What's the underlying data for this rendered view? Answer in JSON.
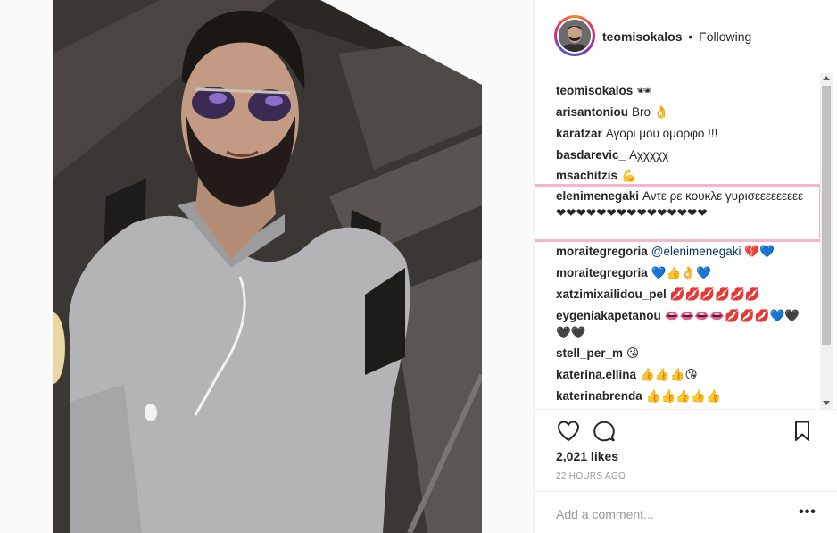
{
  "post": {
    "username": "teomisokalos",
    "separator": "•",
    "follow_status": "Following"
  },
  "comments": [
    {
      "user": "teomisokalos",
      "text": "🕶"
    },
    {
      "user": "arisantoniou",
      "text": "Bro 👌"
    },
    {
      "user": "karatzar",
      "text": "Αγορι μου ομορφο !!!"
    },
    {
      "user": "basdarevic_",
      "text": "Αχχχχχ"
    },
    {
      "user": "msachitzis",
      "text": "💪"
    },
    {
      "user": "elenimenegaki",
      "text": "Αντε ρε κουκλε γυρισεεεεεεεεε ❤❤❤❤❤❤❤❤❤❤❤❤❤❤❤"
    },
    {
      "user": "moraitegregoria",
      "mention": "@elenimenegaki",
      "text": "💔💙"
    },
    {
      "user": "moraitegregoria",
      "text": "💙👍👌💙"
    },
    {
      "user": "xatzimixailidou_pel",
      "text": "💋💋💋💋💋💋"
    },
    {
      "user": "eygeniakapetanou",
      "text": "👄👄👄👄💋💋💋💙🖤🖤🖤"
    },
    {
      "user": "stell_per_m",
      "text": "😘"
    },
    {
      "user": "katerina.ellina",
      "text": "👍👍👍😘"
    },
    {
      "user": "katerinabrenda",
      "text": "👍👍👍👍👍"
    }
  ],
  "actions": {
    "likes": "2,021 likes",
    "timestamp": "22 HOURS AGO",
    "icons": [
      "heart-icon",
      "comment-icon",
      "bookmark-icon",
      "more-options-icon"
    ]
  },
  "composer": {
    "placeholder": "Add a comment...",
    "more_label": "•••"
  },
  "colors": {
    "highlight_border": "#f4b6cf",
    "text_primary": "#262626",
    "text_secondary": "#999999",
    "divider": "#efefef",
    "mention": "#003569"
  }
}
